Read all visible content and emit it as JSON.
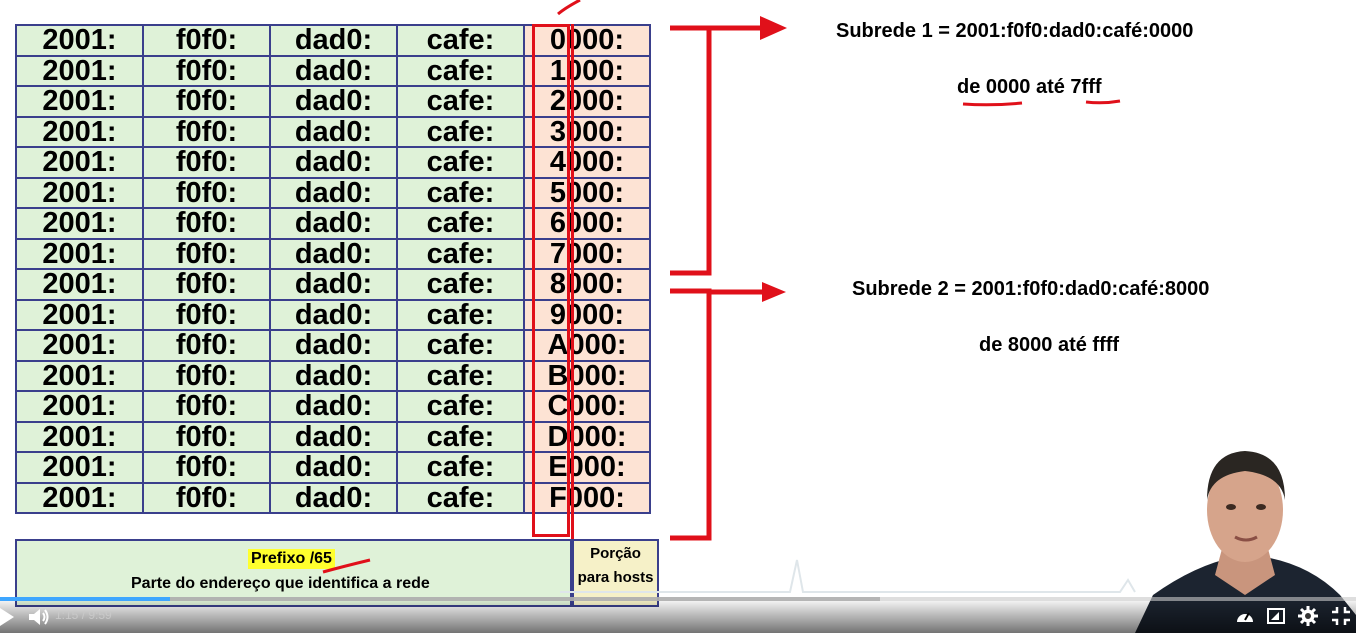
{
  "table": {
    "rows": [
      [
        "2001:",
        "f0f0:",
        "dad0:",
        "cafe:",
        "0000:"
      ],
      [
        "2001:",
        "f0f0:",
        "dad0:",
        "cafe:",
        "1000:"
      ],
      [
        "2001:",
        "f0f0:",
        "dad0:",
        "cafe:",
        "2000:"
      ],
      [
        "2001:",
        "f0f0:",
        "dad0:",
        "cafe:",
        "3000:"
      ],
      [
        "2001:",
        "f0f0:",
        "dad0:",
        "cafe:",
        "4000:"
      ],
      [
        "2001:",
        "f0f0:",
        "dad0:",
        "cafe:",
        "5000:"
      ],
      [
        "2001:",
        "f0f0:",
        "dad0:",
        "cafe:",
        "6000:"
      ],
      [
        "2001:",
        "f0f0:",
        "dad0:",
        "cafe:",
        "7000:"
      ],
      [
        "2001:",
        "f0f0:",
        "dad0:",
        "cafe:",
        "8000:"
      ],
      [
        "2001:",
        "f0f0:",
        "dad0:",
        "cafe:",
        "9000:"
      ],
      [
        "2001:",
        "f0f0:",
        "dad0:",
        "cafe:",
        "A000:"
      ],
      [
        "2001:",
        "f0f0:",
        "dad0:",
        "cafe:",
        "B000:"
      ],
      [
        "2001:",
        "f0f0:",
        "dad0:",
        "cafe:",
        "C000:"
      ],
      [
        "2001:",
        "f0f0:",
        "dad0:",
        "cafe:",
        "D000:"
      ],
      [
        "2001:",
        "f0f0:",
        "dad0:",
        "cafe:",
        "E000:"
      ],
      [
        "2001:",
        "f0f0:",
        "dad0:",
        "cafe:",
        "F000:"
      ]
    ]
  },
  "footer": {
    "prefix": "Prefixo /65",
    "prefix_desc": "Parte do endereço que identifica a rede",
    "host_label": "Porção para hosts"
  },
  "subnets": {
    "one": {
      "title": "Subrede 1 = 2001:f0f0:dad0:café:0000",
      "range": "de 0000 até 7fff"
    },
    "two": {
      "title": "Subrede 2 = 2001:f0f0:dad0:café:8000",
      "range": "de 8000 até ffff"
    }
  },
  "player": {
    "time": "1:15 / 9:59",
    "progress": 0.125,
    "icons": [
      "play-icon",
      "volume-icon",
      "speed-icon",
      "miniplayer-icon",
      "settings-icon",
      "exit-fullscreen-icon"
    ]
  },
  "colors": {
    "network_cell": "#dff2d8",
    "host_cell": "#fde3d4",
    "host_footer": "#f6f1c8",
    "accent_red": "#e0101a",
    "table_border": "#3a3f8c",
    "highlight": "#ffff2e",
    "progress": "#3ea6ff"
  }
}
